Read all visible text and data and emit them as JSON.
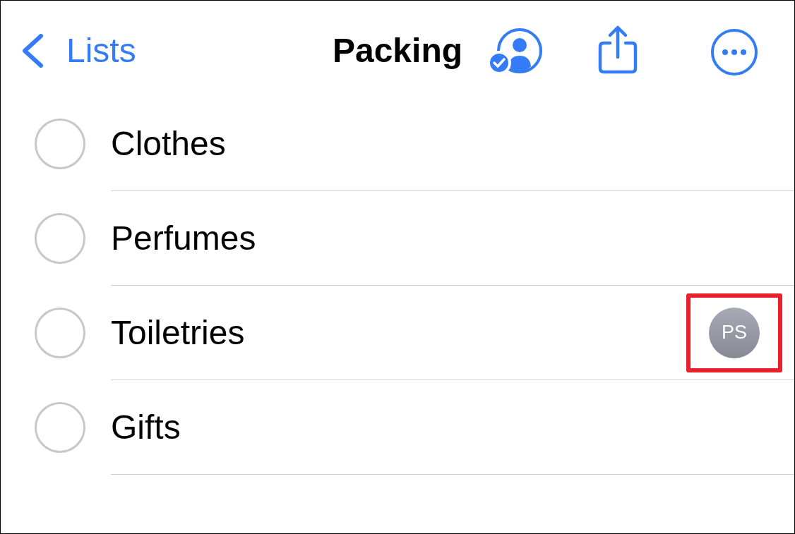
{
  "nav_bar": {
    "back_label": "Lists",
    "title": "Packing"
  },
  "items": [
    {
      "name": "Clothes",
      "completed": false
    },
    {
      "name": "Perfumes",
      "completed": false
    },
    {
      "name": "Toiletries",
      "completed": false,
      "assignee": {
        "initials": "PS",
        "highlighted": true
      }
    },
    {
      "name": "Gifts",
      "completed": false
    }
  ]
}
